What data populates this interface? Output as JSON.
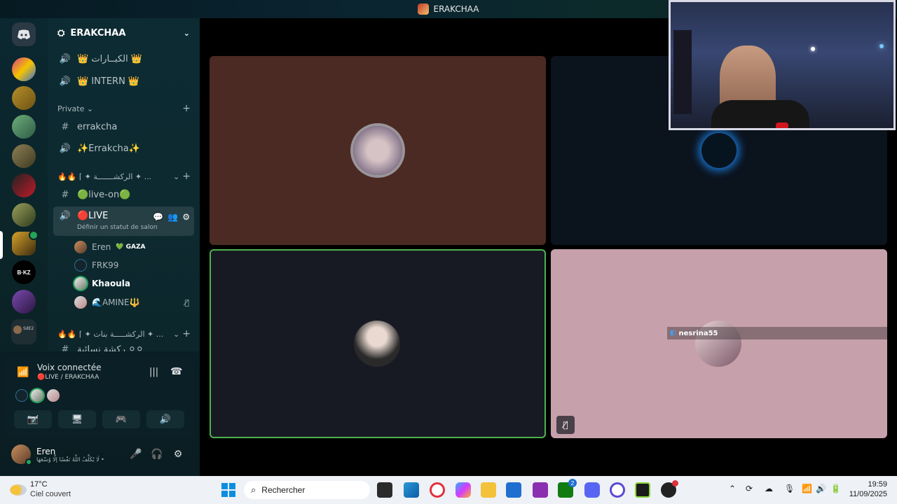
{
  "window": {
    "title": "ERAKCHAA"
  },
  "server": {
    "name": "ERAKCHAA"
  },
  "channels": [
    {
      "type": "voice",
      "label": "👑 الكبــارات 👑"
    },
    {
      "type": "voice",
      "label": "👑 INTERN 👑"
    },
    {
      "type": "category",
      "label": "Private ⌄"
    },
    {
      "type": "text",
      "label": "errakcha"
    },
    {
      "type": "voice",
      "label": "✨Errakcha✨"
    },
    {
      "type": "category",
      "label": "🔥🔥 ⌈ ✦ الركشـــــــة ✦ ..."
    },
    {
      "type": "text",
      "label": "🟢live-on🟢"
    },
    {
      "type": "voice",
      "label": "🔴LIVE",
      "status": "Définir un statut de salon"
    },
    {
      "type": "category",
      "label": "🔥🔥 ⌈ ✦ الركشـــــة بنات ✦ ..."
    },
    {
      "type": "text",
      "label": "ركشة نسائية ⚪⚪"
    }
  ],
  "voice_members": [
    {
      "name": "Eren",
      "tag": "💚 GAZA",
      "bold": false
    },
    {
      "name": "FRK99",
      "tag": "",
      "bold": false
    },
    {
      "name": "Khaoula",
      "tag": "",
      "bold": true
    },
    {
      "name": "🌊AMINE🔱",
      "tag": "",
      "bold": false
    }
  ],
  "voice_panel": {
    "status": "Voix connectée",
    "channel": "🔴LIVE / ERAKCHAA"
  },
  "user_panel": {
    "name": "Eren",
    "status": "لَا يُكَلِّفُ اللَّهُ نَفْسًا إِلَّا وُسْعَهَا •"
  },
  "stage": {
    "tile_label": "nesrina55"
  },
  "taskbar": {
    "weather_temp": "17°C",
    "weather_desc": "Ciel couvert",
    "search_placeholder": "Rechercher",
    "time": "19:59",
    "date": "11/09/2025",
    "badge": "2"
  },
  "colors": {
    "accent_green": "#23a55a",
    "live_red": "#e0323c",
    "tile_brown": "#4a2a22",
    "tile_navy": "#0b131d",
    "tile_dark": "#181a23",
    "tile_pink": "#c6a0aa"
  }
}
